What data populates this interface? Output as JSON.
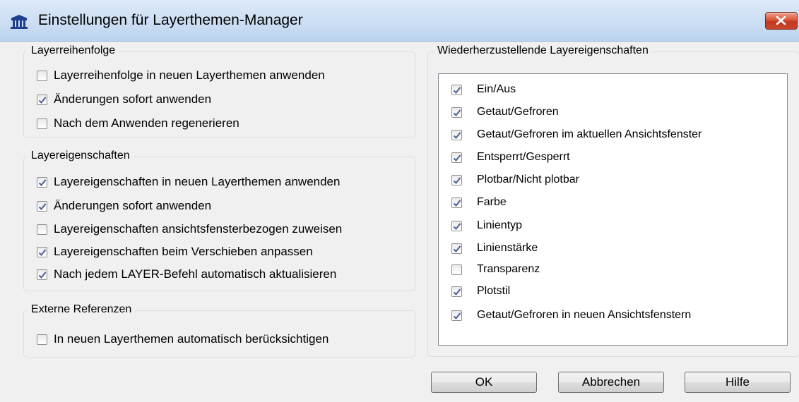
{
  "window": {
    "title": "Einstellungen für Layerthemen-Manager",
    "app_icon": "building-icon",
    "close_icon": "close-icon"
  },
  "colors": {
    "close_button": "#c8462c",
    "checkmark": "#4a5f97",
    "titlebar": "#cfe0f4"
  },
  "groups": {
    "layer_order": {
      "title": "Layerreihenfolge",
      "items": [
        {
          "label": "Layerreihenfolge in neuen Layerthemen anwenden",
          "checked": false
        },
        {
          "label": "Änderungen sofort anwenden",
          "checked": true
        },
        {
          "label": "Nach dem Anwenden regenerieren",
          "checked": false
        }
      ]
    },
    "layer_properties": {
      "title": "Layereigenschaften",
      "items": [
        {
          "label": "Layereigenschaften in neuen Layerthemen anwenden",
          "checked": true
        },
        {
          "label": "Änderungen sofort anwenden",
          "checked": true
        },
        {
          "label": "Layereigenschaften ansichtsfensterbezogen zuweisen",
          "checked": false
        },
        {
          "label": "Layereigenschaften beim Verschieben anpassen",
          "checked": true
        },
        {
          "label": "Nach jedem LAYER-Befehl automatisch aktualisieren",
          "checked": true
        }
      ]
    },
    "xrefs": {
      "title": "Externe Referenzen",
      "items": [
        {
          "label": "In neuen Layerthemen automatisch berücksichtigen",
          "checked": false
        }
      ]
    },
    "restore_properties": {
      "title": "Wiederherzustellende Layereigenschaften",
      "items": [
        {
          "label": "Ein/Aus",
          "checked": true
        },
        {
          "label": "Getaut/Gefroren",
          "checked": true
        },
        {
          "label": "Getaut/Gefroren im aktuellen Ansichtsfenster",
          "checked": true
        },
        {
          "label": "Entsperrt/Gesperrt",
          "checked": true
        },
        {
          "label": "Plotbar/Nicht plotbar",
          "checked": true
        },
        {
          "label": "Farbe",
          "checked": true
        },
        {
          "label": "Linientyp",
          "checked": true
        },
        {
          "label": "Linienstärke",
          "checked": true
        },
        {
          "label": "Transparenz",
          "checked": false
        },
        {
          "label": "Plotstil",
          "checked": true
        },
        {
          "label": "Getaut/Gefroren in neuen Ansichtsfenstern",
          "checked": true
        }
      ]
    }
  },
  "buttons": {
    "ok": "OK",
    "cancel": "Abbrechen",
    "help": "Hilfe"
  }
}
